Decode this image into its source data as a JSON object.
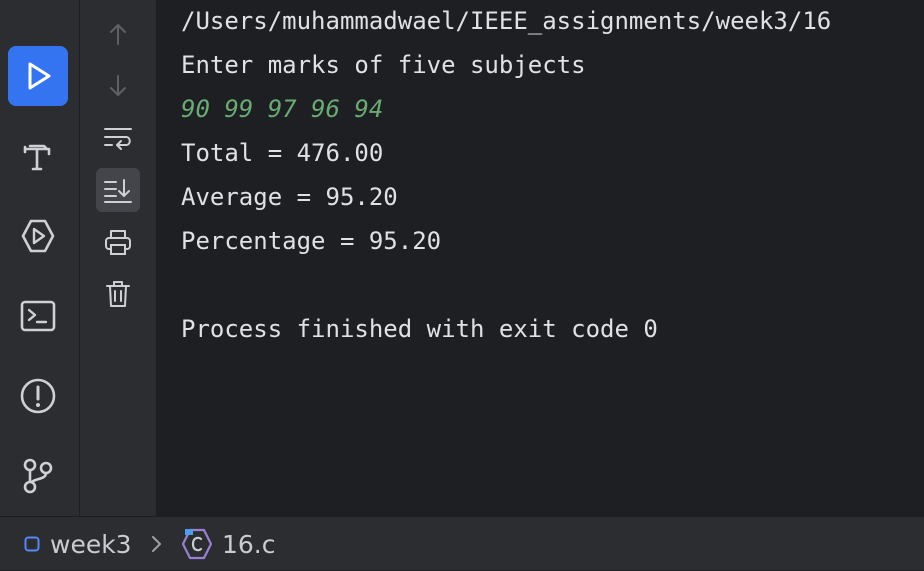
{
  "tool_window": {
    "left_bar": [
      {
        "name": "run",
        "icon": "run-icon",
        "active": true
      },
      {
        "name": "build",
        "icon": "hammer-icon"
      },
      {
        "name": "services",
        "icon": "services-icon"
      },
      {
        "name": "terminal",
        "icon": "terminal-icon"
      },
      {
        "name": "problems",
        "icon": "problems-icon"
      },
      {
        "name": "git",
        "icon": "git-branch-icon"
      }
    ],
    "console_toolbar": [
      {
        "name": "up",
        "icon": "arrow-up-icon",
        "disabled": true
      },
      {
        "name": "down",
        "icon": "arrow-down-icon",
        "disabled": true
      },
      {
        "name": "soft-wrap",
        "icon": "soft-wrap-icon"
      },
      {
        "name": "scroll-to-end",
        "icon": "scroll-to-end-icon",
        "active": true
      },
      {
        "name": "print",
        "icon": "printer-icon"
      },
      {
        "name": "clear",
        "icon": "trash-icon"
      }
    ]
  },
  "console": {
    "lines": [
      {
        "text": "/Users/muhammadwael/IEEE_assignments/week3/16",
        "type": "output"
      },
      {
        "text": "Enter marks of five subjects",
        "type": "output"
      },
      {
        "text": "90 99 97 96 94",
        "type": "input"
      },
      {
        "text": "Total = 476.00",
        "type": "output"
      },
      {
        "text": "Average = 95.20",
        "type": "output"
      },
      {
        "text": "Percentage = 95.20",
        "type": "output"
      },
      {
        "text": "",
        "type": "output"
      },
      {
        "text": "Process finished with exit code 0",
        "type": "output"
      }
    ]
  },
  "statusbar": {
    "breadcrumb_folder": "week3",
    "breadcrumb_separator": ">",
    "breadcrumb_file": "16.c"
  },
  "colors": {
    "accent": "#3574f0",
    "input_text": "#6aab73",
    "console_text": "#dfe1e5"
  }
}
